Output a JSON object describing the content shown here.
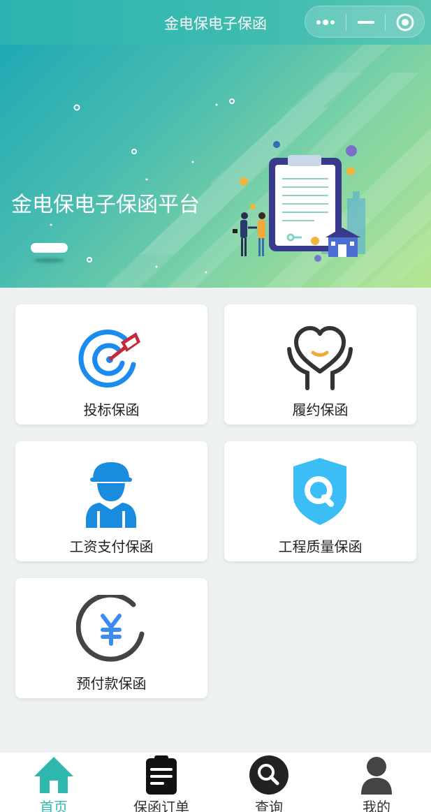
{
  "navbar": {
    "title": "金电保电子保函"
  },
  "banner": {
    "title": "金电保电子保函平台"
  },
  "cards": [
    {
      "label": "投标保函",
      "icon": "target-arrow-icon"
    },
    {
      "label": "履约保函",
      "icon": "heart-hands-icon"
    },
    {
      "label": "工资支付保函",
      "icon": "worker-icon"
    },
    {
      "label": "工程质量保函",
      "icon": "quality-shield-icon"
    },
    {
      "label": "预付款保函",
      "icon": "yen-circle-icon"
    }
  ],
  "tabbar": {
    "items": [
      {
        "label": "首页",
        "icon": "home-icon",
        "active": true
      },
      {
        "label": "保函订单",
        "icon": "order-clipboard-icon",
        "active": false
      },
      {
        "label": "查询",
        "icon": "search-icon",
        "active": false
      },
      {
        "label": "我的",
        "icon": "user-icon",
        "active": false
      }
    ]
  },
  "colors": {
    "accent": "#2fb8b0",
    "card_bg": "#ffffff",
    "page_bg": "#eef1f2"
  }
}
